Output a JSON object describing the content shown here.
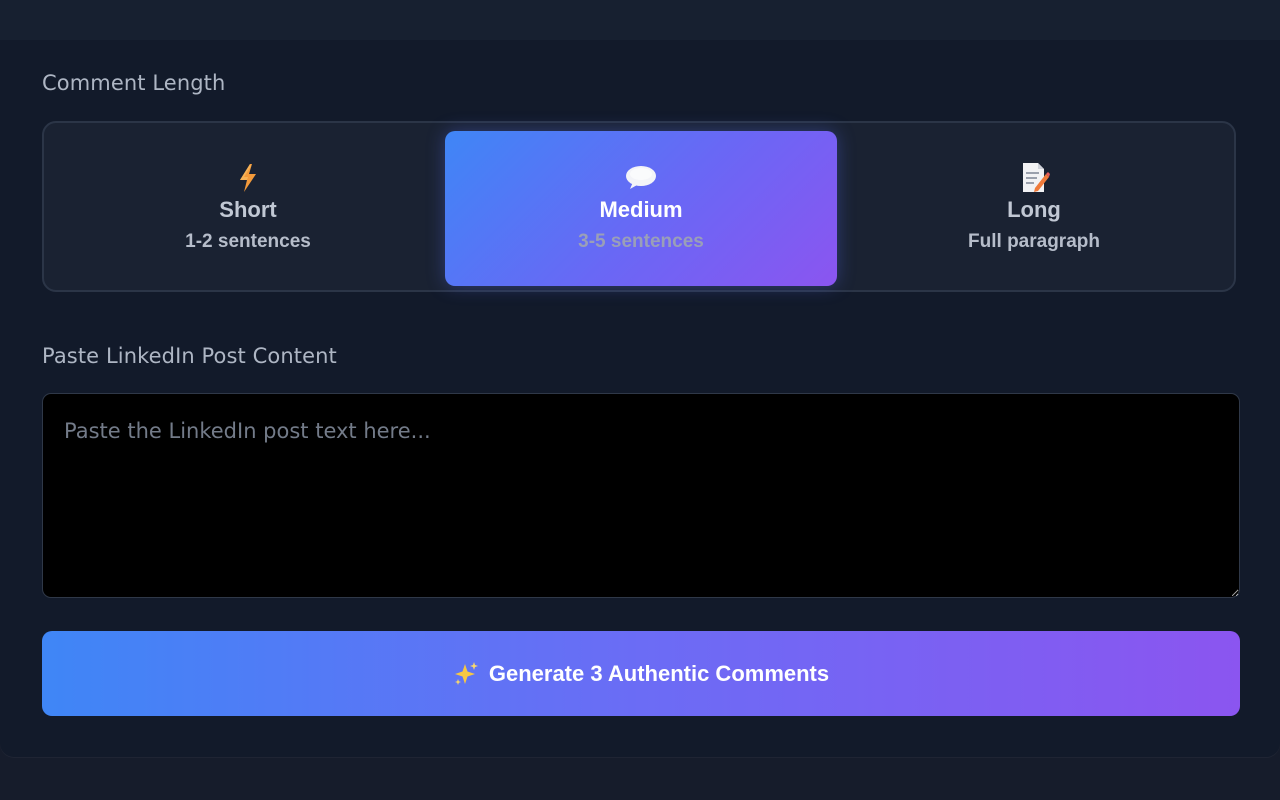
{
  "length_section": {
    "label": "Comment Length",
    "options": [
      {
        "title": "Short",
        "subtitle": "1-2 sentences",
        "icon": "lightning-icon",
        "selected": false
      },
      {
        "title": "Medium",
        "subtitle": "3-5 sentences",
        "icon": "speech-bubble-icon",
        "selected": true
      },
      {
        "title": "Long",
        "subtitle": "Full paragraph",
        "icon": "memo-icon",
        "selected": false
      }
    ]
  },
  "post_section": {
    "label": "Paste LinkedIn Post Content",
    "placeholder": "Paste the LinkedIn post text here...",
    "value": ""
  },
  "generate_button": {
    "label": "Generate 3 Authentic Comments",
    "icon": "sparkles-icon"
  },
  "colors": {
    "background": "#161c2b",
    "card": "#121a2a",
    "accent_start": "#3f86f6",
    "accent_end": "#8b55f0"
  }
}
